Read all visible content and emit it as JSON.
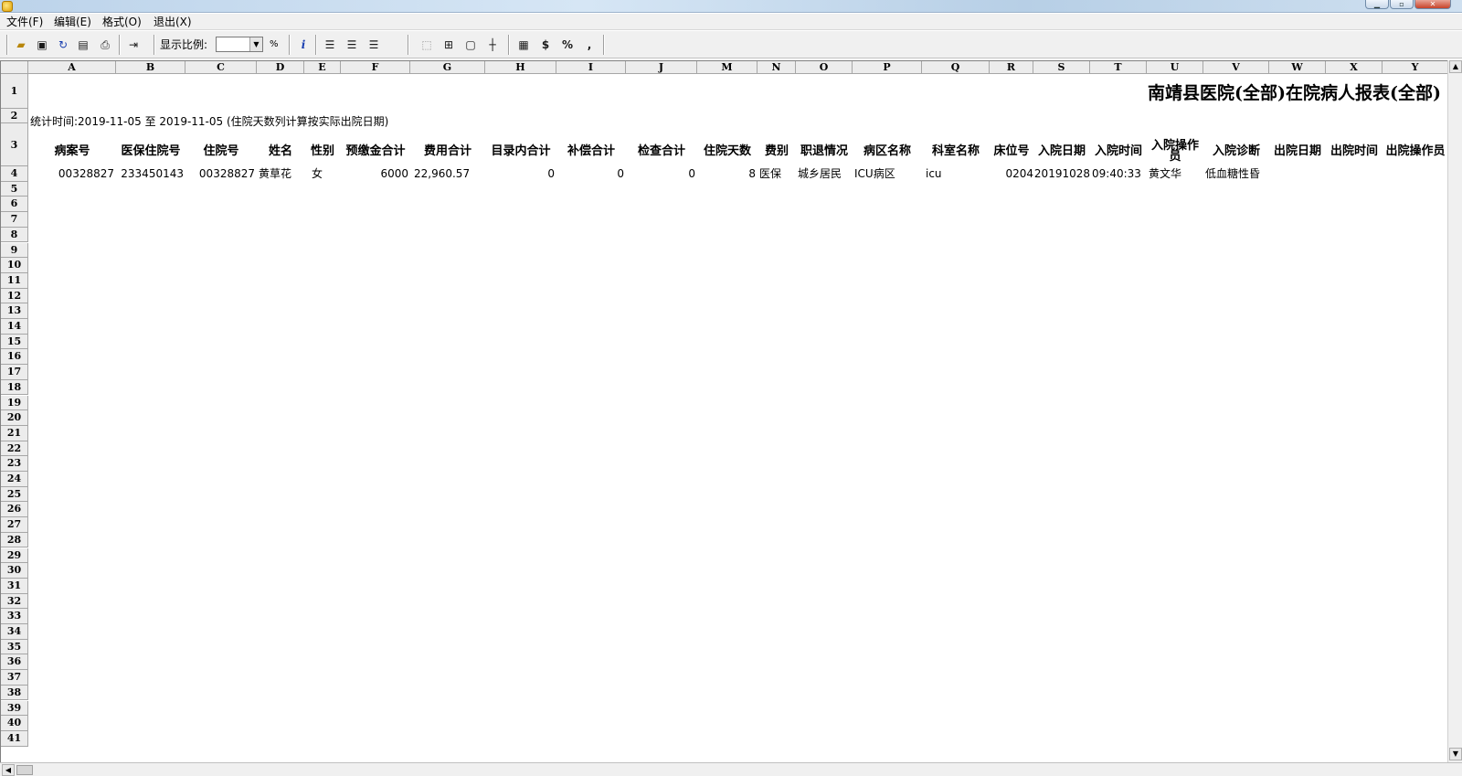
{
  "menu": [
    "文件(F)",
    "编辑(E)",
    "格式(O)",
    "退出(X)"
  ],
  "toolbar": {
    "zoom_label": "显示比例:",
    "zoom_value": "",
    "percent": "%",
    "dollar": "$",
    "comma": ","
  },
  "columns": [
    "A",
    "B",
    "C",
    "D",
    "E",
    "F",
    "G",
    "H",
    "I",
    "J",
    "M",
    "N",
    "O",
    "P",
    "Q",
    "R",
    "S",
    "T",
    "U",
    "V",
    "W",
    "X",
    "Y"
  ],
  "report": {
    "title": "南靖县医院(全部)在院病人报表(全部)",
    "stat_time": "统计时间:2019-11-05 至 2019-11-05 (住院天数列计算按实际出院日期)",
    "headers": [
      "病案号",
      "医保住院号",
      "住院号",
      "姓名",
      "性别",
      "预缴金合计",
      "费用合计",
      "目录内合计",
      "补偿合计",
      "检查合计",
      "住院天数",
      "费别",
      "职退情况",
      "病区名称",
      "科室名称",
      "床位号",
      "入院日期",
      "入院时间",
      "入院操作员",
      "入院诊断",
      "出院日期",
      "出院时间",
      "出院操作员"
    ],
    "row": [
      "00328827",
      "233450143",
      "00328827",
      "黄草花",
      "女",
      "6000",
      "22,960.57",
      "0",
      "0",
      "0",
      "8",
      "医保",
      "城乡居民",
      "ICU病区",
      "icu",
      "0204",
      "20191028",
      "09:40:33",
      "黄文华",
      "低血糖性昏",
      "",
      "",
      ""
    ]
  }
}
